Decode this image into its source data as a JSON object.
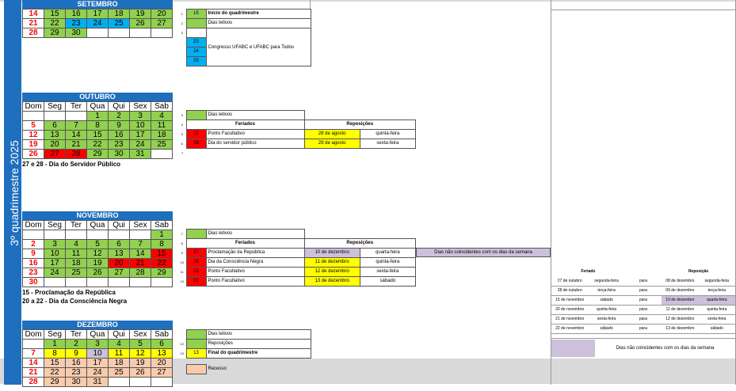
{
  "side_label": "3º quadrimestre 2025",
  "weekdays": [
    "Dom",
    "Seg",
    "Ter",
    "Qua",
    "Qui",
    "Sex",
    "Sab"
  ],
  "months": {
    "setembro": {
      "title": "SETEMBRO",
      "rows": [
        [
          {
            "d": "14",
            "c": "w rt"
          },
          {
            "d": "15",
            "c": "g"
          },
          {
            "d": "16",
            "c": "g"
          },
          {
            "d": "17",
            "c": "g"
          },
          {
            "d": "18",
            "c": "g"
          },
          {
            "d": "19",
            "c": "g"
          },
          {
            "d": "20",
            "c": "g"
          }
        ],
        [
          {
            "d": "21",
            "c": "w rt"
          },
          {
            "d": "22",
            "c": "g"
          },
          {
            "d": "23",
            "c": "b"
          },
          {
            "d": "24",
            "c": "b"
          },
          {
            "d": "25",
            "c": "b"
          },
          {
            "d": "26",
            "c": "g"
          },
          {
            "d": "27",
            "c": "g"
          }
        ],
        [
          {
            "d": "28",
            "c": "w rt"
          },
          {
            "d": "29",
            "c": "g"
          },
          {
            "d": "30",
            "c": "g"
          },
          {
            "d": "",
            "c": "w"
          },
          {
            "d": "",
            "c": "w"
          },
          {
            "d": "",
            "c": "w"
          },
          {
            "d": "",
            "c": "w"
          }
        ]
      ]
    },
    "outubro": {
      "title": "OUTUBRO",
      "rows": [
        [
          {
            "d": "",
            "c": "w"
          },
          {
            "d": "",
            "c": "w"
          },
          {
            "d": "",
            "c": "w"
          },
          {
            "d": "1",
            "c": "g"
          },
          {
            "d": "2",
            "c": "g"
          },
          {
            "d": "3",
            "c": "g"
          },
          {
            "d": "4",
            "c": "g"
          }
        ],
        [
          {
            "d": "5",
            "c": "w rt"
          },
          {
            "d": "6",
            "c": "g"
          },
          {
            "d": "7",
            "c": "g"
          },
          {
            "d": "8",
            "c": "g"
          },
          {
            "d": "9",
            "c": "g"
          },
          {
            "d": "10",
            "c": "g"
          },
          {
            "d": "11",
            "c": "g"
          }
        ],
        [
          {
            "d": "12",
            "c": "w rt"
          },
          {
            "d": "13",
            "c": "g"
          },
          {
            "d": "14",
            "c": "g"
          },
          {
            "d": "15",
            "c": "g"
          },
          {
            "d": "16",
            "c": "g"
          },
          {
            "d": "17",
            "c": "g"
          },
          {
            "d": "18",
            "c": "g"
          }
        ],
        [
          {
            "d": "19",
            "c": "w rt"
          },
          {
            "d": "20",
            "c": "g"
          },
          {
            "d": "21",
            "c": "g"
          },
          {
            "d": "22",
            "c": "g"
          },
          {
            "d": "23",
            "c": "g"
          },
          {
            "d": "24",
            "c": "g"
          },
          {
            "d": "25",
            "c": "g"
          }
        ],
        [
          {
            "d": "26",
            "c": "w rt"
          },
          {
            "d": "27",
            "c": "r"
          },
          {
            "d": "28",
            "c": "r"
          },
          {
            "d": "29",
            "c": "g"
          },
          {
            "d": "30",
            "c": "g"
          },
          {
            "d": "31",
            "c": "g"
          },
          {
            "d": "",
            "c": "w"
          }
        ]
      ],
      "note": "27 e 28  - Dia do Servidor Público"
    },
    "novembro": {
      "title": "NOVEMBRO",
      "rows": [
        [
          {
            "d": "",
            "c": "w"
          },
          {
            "d": "",
            "c": "w"
          },
          {
            "d": "",
            "c": "w"
          },
          {
            "d": "",
            "c": "w"
          },
          {
            "d": "",
            "c": "w"
          },
          {
            "d": "",
            "c": "w"
          },
          {
            "d": "1",
            "c": "g"
          }
        ],
        [
          {
            "d": "2",
            "c": "w rt"
          },
          {
            "d": "3",
            "c": "g"
          },
          {
            "d": "4",
            "c": "g"
          },
          {
            "d": "5",
            "c": "g"
          },
          {
            "d": "6",
            "c": "g"
          },
          {
            "d": "7",
            "c": "g"
          },
          {
            "d": "8",
            "c": "g"
          }
        ],
        [
          {
            "d": "9",
            "c": "w rt"
          },
          {
            "d": "10",
            "c": "g"
          },
          {
            "d": "11",
            "c": "g"
          },
          {
            "d": "12",
            "c": "g"
          },
          {
            "d": "13",
            "c": "g"
          },
          {
            "d": "14",
            "c": "g"
          },
          {
            "d": "15",
            "c": "r"
          }
        ],
        [
          {
            "d": "16",
            "c": "w rt"
          },
          {
            "d": "17",
            "c": "g"
          },
          {
            "d": "18",
            "c": "g"
          },
          {
            "d": "19",
            "c": "g"
          },
          {
            "d": "20",
            "c": "r"
          },
          {
            "d": "21",
            "c": "r"
          },
          {
            "d": "22",
            "c": "r"
          }
        ],
        [
          {
            "d": "23",
            "c": "w rt"
          },
          {
            "d": "24",
            "c": "g"
          },
          {
            "d": "25",
            "c": "g"
          },
          {
            "d": "26",
            "c": "g"
          },
          {
            "d": "27",
            "c": "g"
          },
          {
            "d": "28",
            "c": "g"
          },
          {
            "d": "29",
            "c": "g"
          }
        ],
        [
          {
            "d": "30",
            "c": "w rt"
          },
          {
            "d": "",
            "c": "w"
          },
          {
            "d": "",
            "c": "w"
          },
          {
            "d": "",
            "c": "w"
          },
          {
            "d": "",
            "c": "w"
          },
          {
            "d": "",
            "c": "w"
          },
          {
            "d": "",
            "c": "w"
          }
        ]
      ],
      "note1": "15 - Proclamação da República",
      "note2": "20 a 22 - Dia da Consciência Negra"
    },
    "dezembro": {
      "title": "DEZEMBRO",
      "rows": [
        [
          {
            "d": "",
            "c": "w"
          },
          {
            "d": "1",
            "c": "g"
          },
          {
            "d": "2",
            "c": "g"
          },
          {
            "d": "3",
            "c": "g"
          },
          {
            "d": "4",
            "c": "g"
          },
          {
            "d": "5",
            "c": "g"
          },
          {
            "d": "6",
            "c": "g"
          }
        ],
        [
          {
            "d": "7",
            "c": "w rt"
          },
          {
            "d": "8",
            "c": "y"
          },
          {
            "d": "9",
            "c": "y"
          },
          {
            "d": "10",
            "c": "p"
          },
          {
            "d": "11",
            "c": "y"
          },
          {
            "d": "12",
            "c": "y"
          },
          {
            "d": "13",
            "c": "y"
          }
        ],
        [
          {
            "d": "14",
            "c": "w rt"
          },
          {
            "d": "15",
            "c": "o"
          },
          {
            "d": "16",
            "c": "o"
          },
          {
            "d": "17",
            "c": "o"
          },
          {
            "d": "18",
            "c": "o"
          },
          {
            "d": "19",
            "c": "o"
          },
          {
            "d": "20",
            "c": "o"
          }
        ],
        [
          {
            "d": "21",
            "c": "w rt"
          },
          {
            "d": "22",
            "c": "o"
          },
          {
            "d": "23",
            "c": "o"
          },
          {
            "d": "24",
            "c": "o"
          },
          {
            "d": "25",
            "c": "o"
          },
          {
            "d": "26",
            "c": "o"
          },
          {
            "d": "27",
            "c": "o"
          }
        ],
        [
          {
            "d": "28",
            "c": "w rt"
          },
          {
            "d": "29",
            "c": "o"
          },
          {
            "d": "30",
            "c": "o"
          },
          {
            "d": "31",
            "c": "o"
          },
          {
            "d": "",
            "c": "w"
          },
          {
            "d": "",
            "c": "w"
          },
          {
            "d": "",
            "c": "w"
          }
        ]
      ]
    }
  },
  "events": {
    "set": {
      "n1": "1",
      "n2": "2",
      "n3": "3",
      "sw1": "15",
      "l1": "Início do quadrimestre",
      "l2": "Dias letivos",
      "sw3": "23",
      "sw4": "24",
      "sw5": "25",
      "l3": "Congresso UFABC e UFABC para Todos"
    },
    "out": {
      "n1": "3",
      "n2": "4",
      "n3": "5",
      "n4": "6",
      "n5": "7",
      "l1": "Dias letivos",
      "h1": "Feriados",
      "h2": "Reposições",
      "sw2": "27",
      "sw3": "28",
      "l2": "Ponto Facultativo",
      "l3": "Dia do servidor público",
      "d2": "28 de agosto",
      "d3": "29 de agosto",
      "w2": "quinta-feira",
      "w3": "sexta-feira"
    },
    "nov": {
      "n1": "7",
      "n2": "8",
      "n3": "9",
      "n4": "10",
      "n5": "11",
      "n6": "12",
      "l1": "Dias letivos",
      "h1": "Feriados",
      "h2": "Reposições",
      "rows": [
        {
          "sw": "15",
          "label": "Proclamação da República",
          "date": "10 de dezembro",
          "wd": "quarta-feira",
          "dc": "p"
        },
        {
          "sw": "20",
          "label": "Dia da Consciência Negra",
          "date": "11 de dezembro",
          "wd": "quinta-feira",
          "dc": "y"
        },
        {
          "sw": "21",
          "label": "Ponto Facultativo",
          "date": "12 de dezembro",
          "wd": "sexta-feira",
          "dc": "y"
        },
        {
          "sw": "22",
          "label": "Ponto Facultativo",
          "date": "13 de dezembro",
          "wd": "sábado",
          "dc": "y"
        }
      ],
      "note": "Dias não coincidentes com os dias da semana"
    },
    "dez": {
      "n1": "12",
      "n2": "13",
      "l1": "Dias letivos",
      "l2": "Reposições",
      "sw3": "13",
      "l3": "Final do quadrimestre",
      "l4": "Recesso"
    }
  },
  "summary": {
    "h1": "Feriado",
    "h2": "Reposição",
    "para": "para",
    "rows": [
      [
        "27 de outubro",
        "segunda-feira",
        "08 de dezembro",
        "segunda-feira"
      ],
      [
        "28 de outubro",
        "terça-feira",
        "09 de dezembro",
        "terça-feira"
      ],
      [
        "15 de novembro",
        "sábado",
        "10 de dezembro",
        "quarta-feira"
      ],
      [
        "20 de novembro",
        "quinta-feira",
        "11 de dezembro",
        "quinta-feira"
      ],
      [
        "21 de novembro",
        "sexta-feira",
        "12 de dezembro",
        "sexta-feira"
      ],
      [
        "22 de novembro",
        "sábado",
        "13 de dezembro",
        "sábado"
      ]
    ],
    "note": "Dias não coincidentes com os dias da semana"
  },
  "colors": {
    "letivo": "#92d050",
    "congresso": "#00b0f0",
    "feriado": "#ff0000",
    "reposicao": "#ffff00",
    "nao_coincidente": "#ccc0da",
    "recesso": "#f8cbad",
    "header": "#1f6fbf"
  }
}
